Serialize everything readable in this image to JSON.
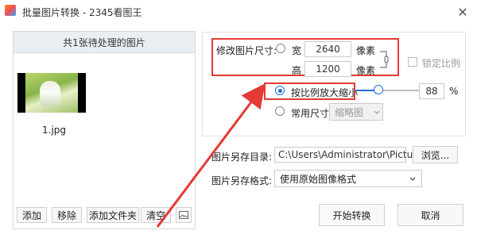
{
  "window": {
    "title": "批量图片转换 - 2345看图王"
  },
  "left_panel": {
    "header": "共1张待处理的图片",
    "file_name": "1.jpg",
    "buttons": {
      "add": "添加",
      "remove": "移除",
      "add_folder": "添加文件夹",
      "clear": "清空"
    }
  },
  "resize": {
    "modify_label": "修改图片尺寸:",
    "width_label": "宽",
    "width_value": "2640",
    "height_label": "高",
    "height_value": "1200",
    "unit": "像素",
    "lock_ratio_label": "锁定比例",
    "scale_label": "按比例放大缩小",
    "scale_value": "88",
    "percent": "%",
    "common_size_label": "常用尺寸",
    "common_size_value": "缩略图"
  },
  "output": {
    "dir_label": "图片另存目录:",
    "dir_value": "C:\\Users\\Administrator\\Pictures\\",
    "browse": "浏览...",
    "format_label": "图片另存格式:",
    "format_value": "使用原始图像格式"
  },
  "actions": {
    "start": "开始转换",
    "cancel": "取消"
  },
  "colors": {
    "accent": "#1f6fd6",
    "annotation_red": "#e53935"
  }
}
